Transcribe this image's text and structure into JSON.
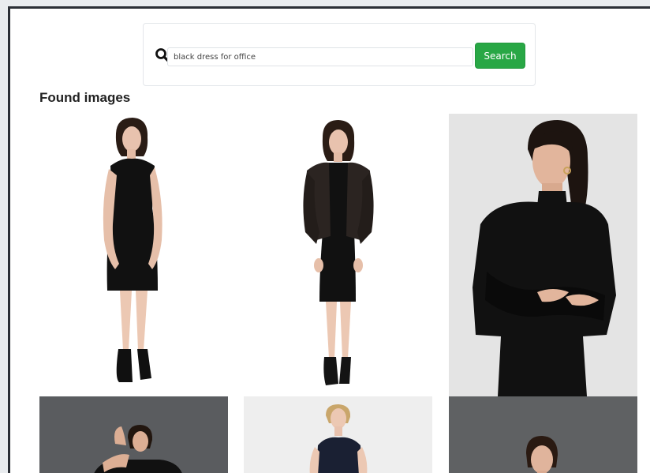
{
  "search": {
    "query": "black dress for office",
    "button_label": "Search"
  },
  "results": {
    "heading": "Found images",
    "images": [
      {
        "subject": "woman in sleeveless black sheath dress",
        "background": "#ffffff"
      },
      {
        "subject": "woman in black dress with black leather jacket",
        "background": "#ffffff"
      },
      {
        "subject": "woman in black long-sleeve turtleneck dress, arms crossed",
        "background": "#e4e4e4"
      },
      {
        "subject": "woman in black dress on dark grey background",
        "background": "#5a5c5f"
      },
      {
        "subject": "blonde woman in navy dress",
        "background": "#eeeeee"
      },
      {
        "subject": "woman in black dress on dark grey background",
        "background": "#5f6163"
      }
    ]
  },
  "colors": {
    "accent_green": "#28a745",
    "window_border": "#2b2f36",
    "dress_black": "#111111",
    "skin": "#e8c2ae",
    "hair": "#2a1c15"
  }
}
